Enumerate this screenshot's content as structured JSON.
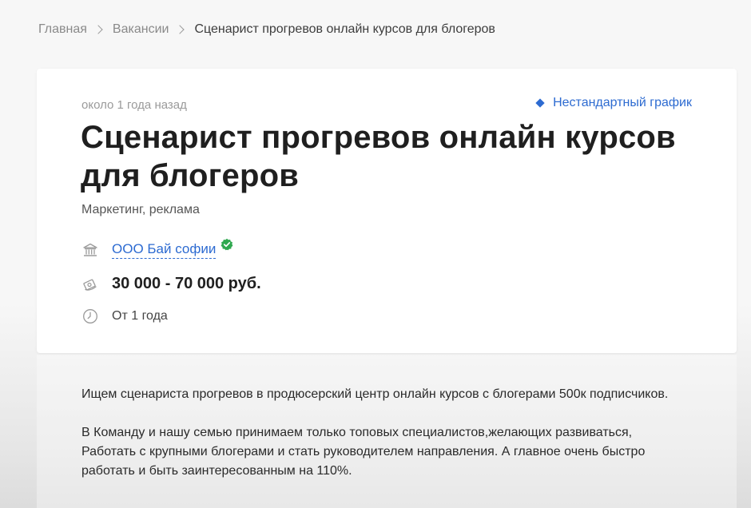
{
  "breadcrumb": {
    "home": "Главная",
    "section": "Вакансии",
    "current": "Сценарист прогревов онлайн курсов для блогеров"
  },
  "job": {
    "posted": "около 1 года назад",
    "schedule": "Нестандартный график",
    "title": "Сценарист прогревов онлайн курсов для блогеров",
    "category": "Маркетинг, реклама",
    "company": "ООО Бай софии",
    "salary": "30 000 - 70 000 руб.",
    "experience": "От 1 года"
  },
  "description": {
    "paragraph1": "Ищем сценариста прогревов в продюсерский центр онлайн курсов с блогерами 500к подписчиков.",
    "paragraph2": "В Команду и нашу семью принимаем только топовых специалистов,желающих развиваться, Работать с крупными блогерами и стать руководителем направления. А главное очень быстро работать и быть заинтересованным на 110%."
  },
  "colors": {
    "accent": "#2d6bd1",
    "verified": "#2fa84f"
  },
  "icons": {
    "company": "building-icon",
    "verified": "verified-badge-icon",
    "salary": "money-icon",
    "experience": "clock-icon",
    "schedule": "diamond-icon"
  }
}
